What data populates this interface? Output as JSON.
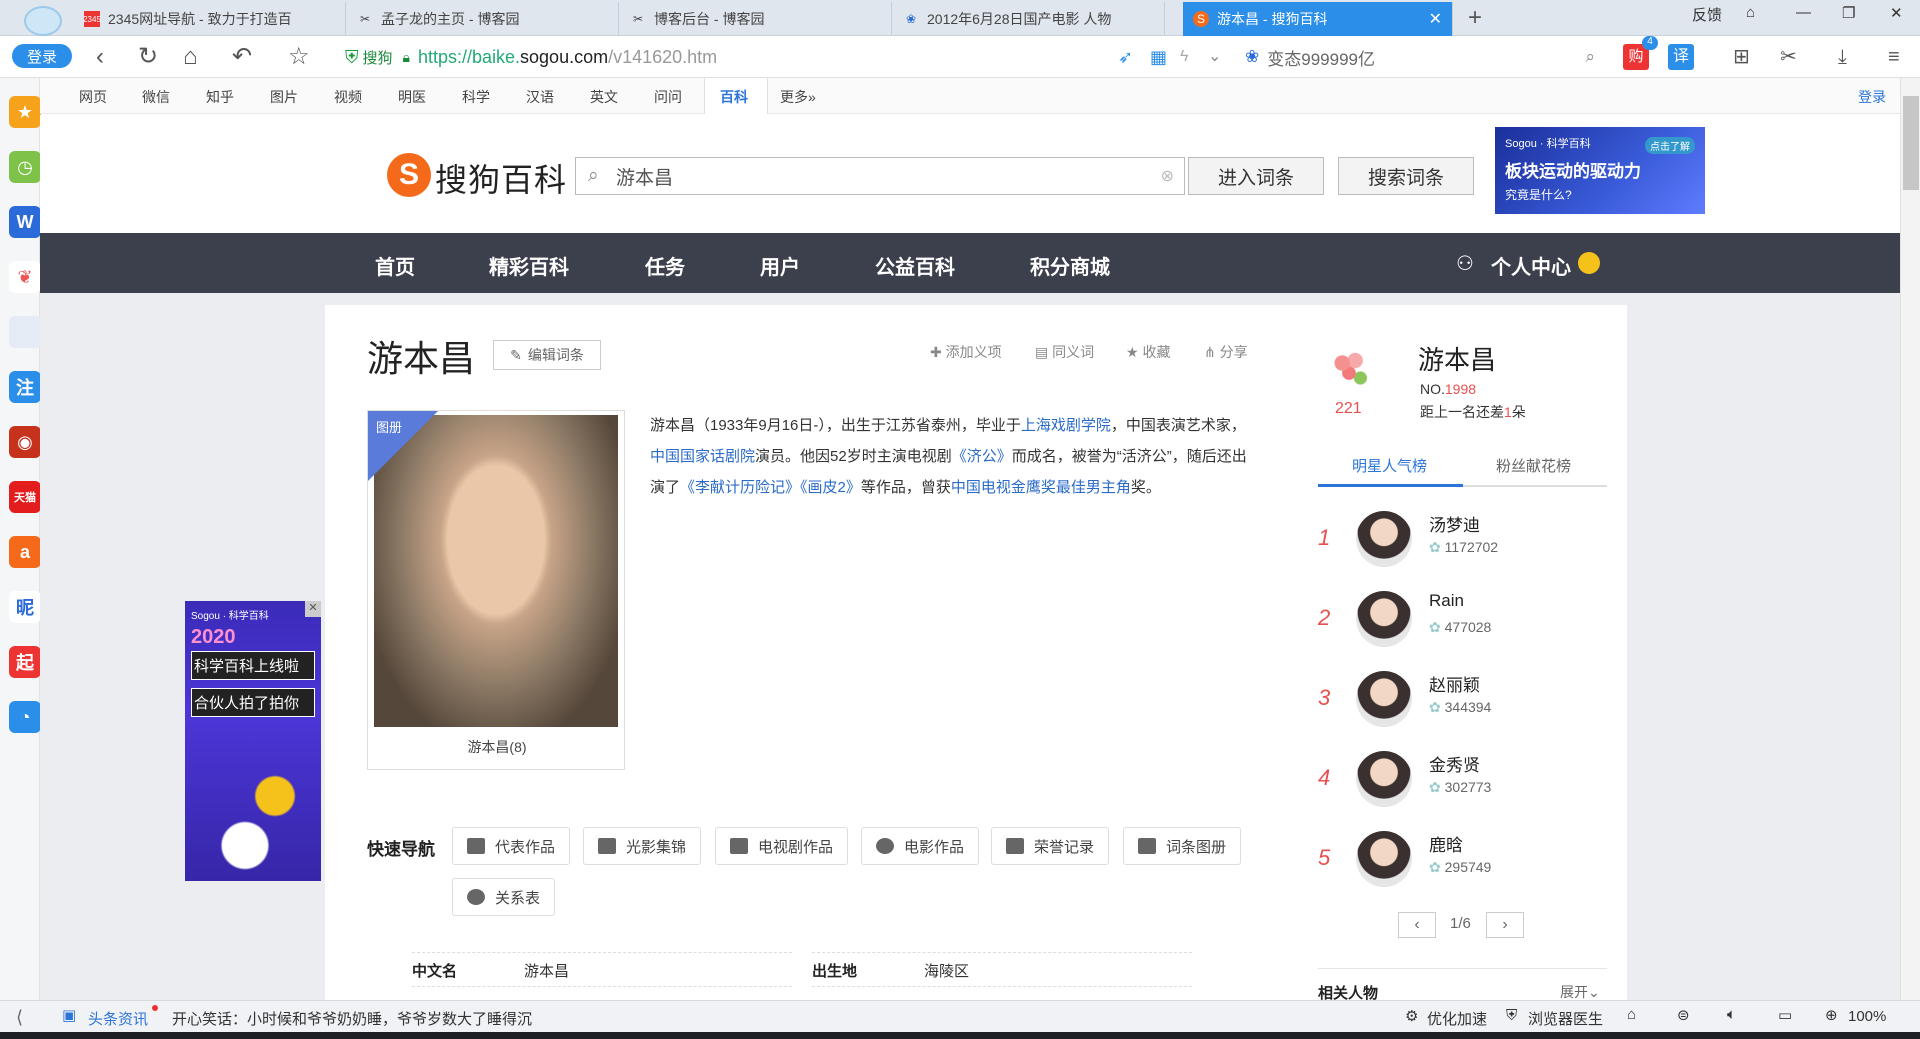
{
  "browser": {
    "login_label": "登录",
    "tabs": [
      {
        "label": "2345网址导航 - 致力于打造百",
        "favicon": "2345-icon"
      },
      {
        "label": "孟子龙的主页 - 博客园",
        "favicon": "cnblogs-icon"
      },
      {
        "label": "博客后台 - 博客园",
        "favicon": "cnblogs-icon"
      },
      {
        "label": "2012年6月28日国产电影 人物",
        "favicon": "baidu-paw-icon"
      },
      {
        "label": "游本昌 - 搜狗百科",
        "favicon": "sogou-icon"
      }
    ],
    "feedback": "反馈",
    "secure_label": "搜狗",
    "url_prefix": "https://baike.",
    "url_domain": "sogou.com",
    "url_suffix": "/v141620.htm",
    "search_query": "变态999999亿",
    "badge_count": "4",
    "translate_label": "译"
  },
  "sogou_nav": {
    "items": [
      "网页",
      "微信",
      "知乎",
      "图片",
      "视频",
      "明医",
      "科学",
      "汉语",
      "英文",
      "问问",
      "百科",
      "更多»"
    ],
    "login": "登录"
  },
  "header": {
    "logo_text": "搜狗百科",
    "search_value": "游本昌",
    "enter_btn": "进入词条",
    "search_btn": "搜索词条",
    "ad_brand": "Sogou · 科学百科",
    "ad_tag": "点击了解",
    "ad_title": "板块运动的驱动力",
    "ad_sub": "究竟是什么?"
  },
  "main_nav": {
    "items": [
      "首页",
      "精彩百科",
      "任务",
      "用户",
      "公益百科",
      "积分商城"
    ],
    "user_center": "个人中心"
  },
  "entry": {
    "title": "游本昌",
    "edit_btn": "编辑词条",
    "actions": [
      "添加义项",
      "同义词",
      "收藏",
      "分享"
    ],
    "album_label": "图册",
    "caption": "游本昌(8)",
    "intro_parts": [
      {
        "text": "游本昌（1933年9月16日-），出生于江苏省泰州，毕业于",
        "link": false
      },
      {
        "text": "上海戏剧学院",
        "link": true
      },
      {
        "text": "，中国表演艺术家，",
        "link": false
      },
      {
        "text": "中国国家话剧院",
        "link": true
      },
      {
        "text": "演员。他因52岁时主演电视剧",
        "link": false
      },
      {
        "text": "《济公》",
        "link": true
      },
      {
        "text": "而成名，被誉为“活济公”，随后还出演了",
        "link": false
      },
      {
        "text": "《李献计历险记》",
        "link": true
      },
      {
        "text": "《画皮2》",
        "link": true
      },
      {
        "text": "等作品，曾获",
        "link": false
      },
      {
        "text": "中国电视金鹰奖最佳男主角",
        "link": true
      },
      {
        "text": "奖。",
        "link": false
      }
    ],
    "quicknav_title": "快速导航",
    "quicknav": [
      "代表作品",
      "光影集锦",
      "电视剧作品",
      "电影作品",
      "荣誉记录",
      "词条图册",
      "关系表"
    ],
    "info": [
      {
        "label": "中文名",
        "value": "游本昌"
      },
      {
        "label": "出生地",
        "value": "海陵区"
      }
    ]
  },
  "side_ad": {
    "brand": "Sogou · 科学百科",
    "year": "2020",
    "line1": "科学百科上线啦",
    "line2": "合伙人拍了拍你"
  },
  "sidebar": {
    "flowers": "221",
    "name": "游本昌",
    "rank_prefix": "NO.",
    "rank": "1998",
    "gap_text_pre": "距上一名还差",
    "gap_num": "1",
    "gap_text_post": "朵",
    "tab_active": "明星人气榜",
    "tab_other": "粉丝献花榜",
    "ranking": [
      {
        "rank": "1",
        "name": "汤梦迪",
        "score": "1172702"
      },
      {
        "rank": "2",
        "name": "Rain",
        "score": "477028"
      },
      {
        "rank": "3",
        "name": "赵丽颖",
        "score": "344394"
      },
      {
        "rank": "4",
        "name": "金秀贤",
        "score": "302773"
      },
      {
        "rank": "5",
        "name": "鹿晗",
        "score": "295749"
      }
    ],
    "page": "1/6",
    "related": "相关人物",
    "expand": "展开"
  },
  "statusbar": {
    "news_label": "头条资讯",
    "news_text": "开心笑话：小时候和爷爷奶奶睡，爷爷岁数大了睡得沉",
    "accelerate": "优化加速",
    "doctor": "浏览器医生",
    "zoom": "100%"
  }
}
